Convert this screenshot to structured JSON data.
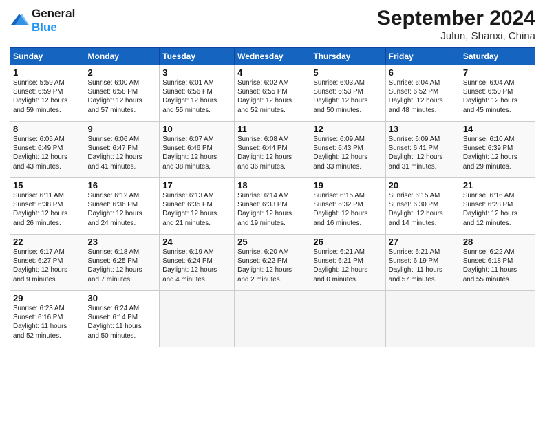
{
  "header": {
    "logo_line1": "General",
    "logo_line2": "Blue",
    "month_title": "September 2024",
    "location": "Julun, Shanxi, China"
  },
  "weekdays": [
    "Sunday",
    "Monday",
    "Tuesday",
    "Wednesday",
    "Thursday",
    "Friday",
    "Saturday"
  ],
  "weeks": [
    [
      {
        "day": "1",
        "info": "Sunrise: 5:59 AM\nSunset: 6:59 PM\nDaylight: 12 hours\nand 59 minutes."
      },
      {
        "day": "2",
        "info": "Sunrise: 6:00 AM\nSunset: 6:58 PM\nDaylight: 12 hours\nand 57 minutes."
      },
      {
        "day": "3",
        "info": "Sunrise: 6:01 AM\nSunset: 6:56 PM\nDaylight: 12 hours\nand 55 minutes."
      },
      {
        "day": "4",
        "info": "Sunrise: 6:02 AM\nSunset: 6:55 PM\nDaylight: 12 hours\nand 52 minutes."
      },
      {
        "day": "5",
        "info": "Sunrise: 6:03 AM\nSunset: 6:53 PM\nDaylight: 12 hours\nand 50 minutes."
      },
      {
        "day": "6",
        "info": "Sunrise: 6:04 AM\nSunset: 6:52 PM\nDaylight: 12 hours\nand 48 minutes."
      },
      {
        "day": "7",
        "info": "Sunrise: 6:04 AM\nSunset: 6:50 PM\nDaylight: 12 hours\nand 45 minutes."
      }
    ],
    [
      {
        "day": "8",
        "info": "Sunrise: 6:05 AM\nSunset: 6:49 PM\nDaylight: 12 hours\nand 43 minutes."
      },
      {
        "day": "9",
        "info": "Sunrise: 6:06 AM\nSunset: 6:47 PM\nDaylight: 12 hours\nand 41 minutes."
      },
      {
        "day": "10",
        "info": "Sunrise: 6:07 AM\nSunset: 6:46 PM\nDaylight: 12 hours\nand 38 minutes."
      },
      {
        "day": "11",
        "info": "Sunrise: 6:08 AM\nSunset: 6:44 PM\nDaylight: 12 hours\nand 36 minutes."
      },
      {
        "day": "12",
        "info": "Sunrise: 6:09 AM\nSunset: 6:43 PM\nDaylight: 12 hours\nand 33 minutes."
      },
      {
        "day": "13",
        "info": "Sunrise: 6:09 AM\nSunset: 6:41 PM\nDaylight: 12 hours\nand 31 minutes."
      },
      {
        "day": "14",
        "info": "Sunrise: 6:10 AM\nSunset: 6:39 PM\nDaylight: 12 hours\nand 29 minutes."
      }
    ],
    [
      {
        "day": "15",
        "info": "Sunrise: 6:11 AM\nSunset: 6:38 PM\nDaylight: 12 hours\nand 26 minutes."
      },
      {
        "day": "16",
        "info": "Sunrise: 6:12 AM\nSunset: 6:36 PM\nDaylight: 12 hours\nand 24 minutes."
      },
      {
        "day": "17",
        "info": "Sunrise: 6:13 AM\nSunset: 6:35 PM\nDaylight: 12 hours\nand 21 minutes."
      },
      {
        "day": "18",
        "info": "Sunrise: 6:14 AM\nSunset: 6:33 PM\nDaylight: 12 hours\nand 19 minutes."
      },
      {
        "day": "19",
        "info": "Sunrise: 6:15 AM\nSunset: 6:32 PM\nDaylight: 12 hours\nand 16 minutes."
      },
      {
        "day": "20",
        "info": "Sunrise: 6:15 AM\nSunset: 6:30 PM\nDaylight: 12 hours\nand 14 minutes."
      },
      {
        "day": "21",
        "info": "Sunrise: 6:16 AM\nSunset: 6:28 PM\nDaylight: 12 hours\nand 12 minutes."
      }
    ],
    [
      {
        "day": "22",
        "info": "Sunrise: 6:17 AM\nSunset: 6:27 PM\nDaylight: 12 hours\nand 9 minutes."
      },
      {
        "day": "23",
        "info": "Sunrise: 6:18 AM\nSunset: 6:25 PM\nDaylight: 12 hours\nand 7 minutes."
      },
      {
        "day": "24",
        "info": "Sunrise: 6:19 AM\nSunset: 6:24 PM\nDaylight: 12 hours\nand 4 minutes."
      },
      {
        "day": "25",
        "info": "Sunrise: 6:20 AM\nSunset: 6:22 PM\nDaylight: 12 hours\nand 2 minutes."
      },
      {
        "day": "26",
        "info": "Sunrise: 6:21 AM\nSunset: 6:21 PM\nDaylight: 12 hours\nand 0 minutes."
      },
      {
        "day": "27",
        "info": "Sunrise: 6:21 AM\nSunset: 6:19 PM\nDaylight: 11 hours\nand 57 minutes."
      },
      {
        "day": "28",
        "info": "Sunrise: 6:22 AM\nSunset: 6:18 PM\nDaylight: 11 hours\nand 55 minutes."
      }
    ],
    [
      {
        "day": "29",
        "info": "Sunrise: 6:23 AM\nSunset: 6:16 PM\nDaylight: 11 hours\nand 52 minutes."
      },
      {
        "day": "30",
        "info": "Sunrise: 6:24 AM\nSunset: 6:14 PM\nDaylight: 11 hours\nand 50 minutes."
      },
      {
        "day": "",
        "info": ""
      },
      {
        "day": "",
        "info": ""
      },
      {
        "day": "",
        "info": ""
      },
      {
        "day": "",
        "info": ""
      },
      {
        "day": "",
        "info": ""
      }
    ]
  ]
}
